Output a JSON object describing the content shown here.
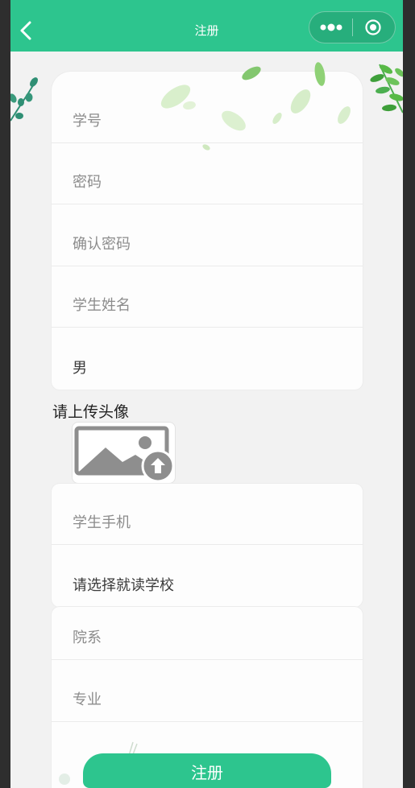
{
  "header": {
    "title": "注册",
    "back_icon": "chevron-left-icon",
    "more_icon": "more-dots-icon",
    "home_icon": "target-circle-icon"
  },
  "account_fields": [
    {
      "placeholder": "学号"
    },
    {
      "placeholder": "密码"
    },
    {
      "placeholder": "确认密码"
    },
    {
      "placeholder": "学生姓名"
    }
  ],
  "gender_picker": {
    "value": "男"
  },
  "avatar": {
    "label": "请上传头像",
    "icon": "image-upload-icon"
  },
  "contact_fields": [
    {
      "placeholder": "学生手机"
    }
  ],
  "school_picker": {
    "value": "请选择就读学校"
  },
  "study_fields": [
    {
      "placeholder": "院系"
    },
    {
      "placeholder": "专业"
    }
  ],
  "submit": {
    "label": "注册"
  },
  "colors": {
    "primary": "#2dc58e",
    "placeholder": "#8c8c8c",
    "value_text": "#3a3a3a",
    "background": "#f2f2f2"
  }
}
